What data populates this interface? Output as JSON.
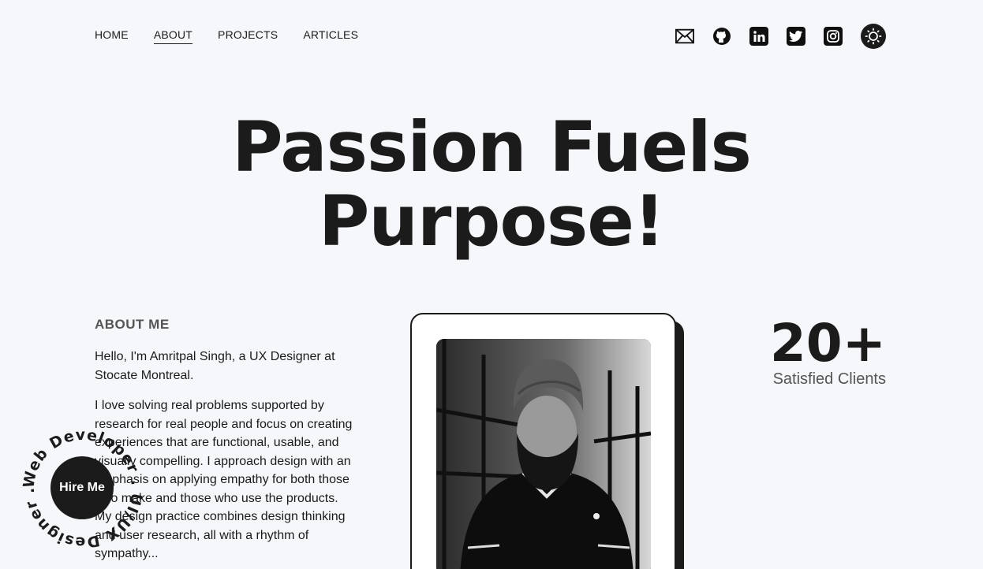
{
  "nav": {
    "items": [
      "HOME",
      "ABOUT",
      "PROJECTS",
      "ARTICLES"
    ],
    "active": "ABOUT"
  },
  "social_icons": [
    "mail-icon",
    "github-icon",
    "linkedin-icon",
    "twitter-icon",
    "instagram-icon"
  ],
  "theme_toggle_icon": "sun-icon",
  "hero": {
    "line1": "Passion Fuels",
    "line2": "Purpose!"
  },
  "about": {
    "heading": "ABOUT ME",
    "intro": "Hello, I'm Amritpal Singh, a UX Designer at Stocate Montreal.",
    "body": "I love solving real problems supported by research for real people and focus on creating experiences that are functional, usable, and visually compelling. I approach design with an emphasis on applying empathy for both those who make and those who use the products. My design practice combines design thinking and user research, all with a rhythm of sympathy..."
  },
  "stat": {
    "number": "20+",
    "label": "Satisfied Clients"
  },
  "hire": {
    "button_label": "Hire Me",
    "circular_text": "Web Developer . UI/UX Designer . "
  },
  "colors": {
    "background": "#f5f7fb",
    "text": "#1b1b1b",
    "muted": "#555555"
  }
}
